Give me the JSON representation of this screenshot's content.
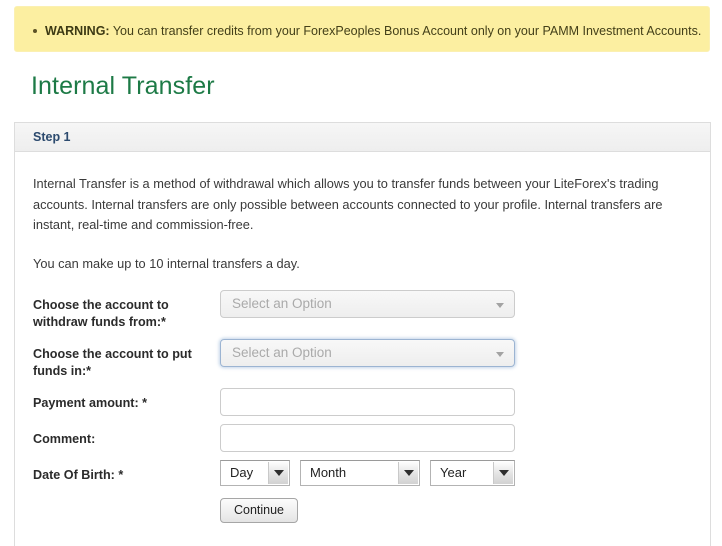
{
  "warning": {
    "label": "WARNING:",
    "text": " You can transfer credits from your ForexPeoples Bonus Account only on your PAMM Investment Accounts.",
    "bg_color": "#fcefa1",
    "text_color": "#444019"
  },
  "page": {
    "title": "Internal Transfer",
    "title_color": "#1d7a46"
  },
  "panel": {
    "header_title": "Step 1",
    "header_color": "#2c4a6e",
    "intro_paragraph": "Internal Transfer is a method of withdrawal which allows you to transfer funds between your LiteForex's trading accounts. Internal transfers are only possible between accounts connected to your profile. Internal transfers are instant, real-time and commission-free.",
    "note_paragraph": "You can make up to 10 internal transfers a day."
  },
  "form": {
    "withdraw_from": {
      "label": "Choose the account to withdraw funds from:*",
      "value": "Select an Option",
      "focused": false
    },
    "put_funds_in": {
      "label": "Choose the account to put funds in:*",
      "value": "Select an Option",
      "focused": true
    },
    "payment_amount": {
      "label": "Payment amount: *",
      "value": "",
      "placeholder": ""
    },
    "comment": {
      "label": "Comment:",
      "value": "",
      "placeholder": ""
    },
    "date_of_birth": {
      "label": "Date Of Birth: *",
      "day": "Day",
      "month": "Month",
      "year": "Year"
    },
    "submit_label": "Continue"
  }
}
